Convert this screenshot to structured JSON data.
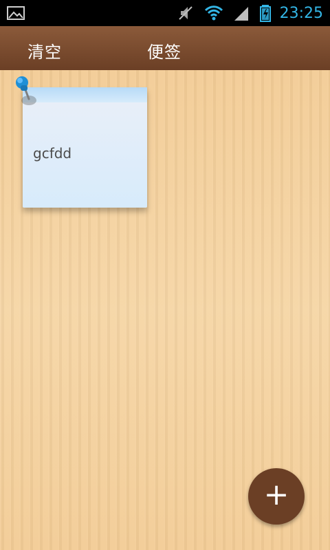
{
  "status_bar": {
    "time": "23:25",
    "icons": [
      "image-icon",
      "mute-icon",
      "wifi-icon",
      "signal-icon",
      "battery-icon"
    ],
    "accent_color": "#33b5e5"
  },
  "toolbar": {
    "clear_label": "清空",
    "title": "便签",
    "background_color": "#7a4b2f"
  },
  "notes": [
    {
      "text": "gcfdd",
      "pin_icon": "pushpin-icon",
      "color": "#dbe9f9"
    }
  ],
  "fab": {
    "label": "+",
    "icon": "plus-icon",
    "color": "#6b3f25"
  }
}
